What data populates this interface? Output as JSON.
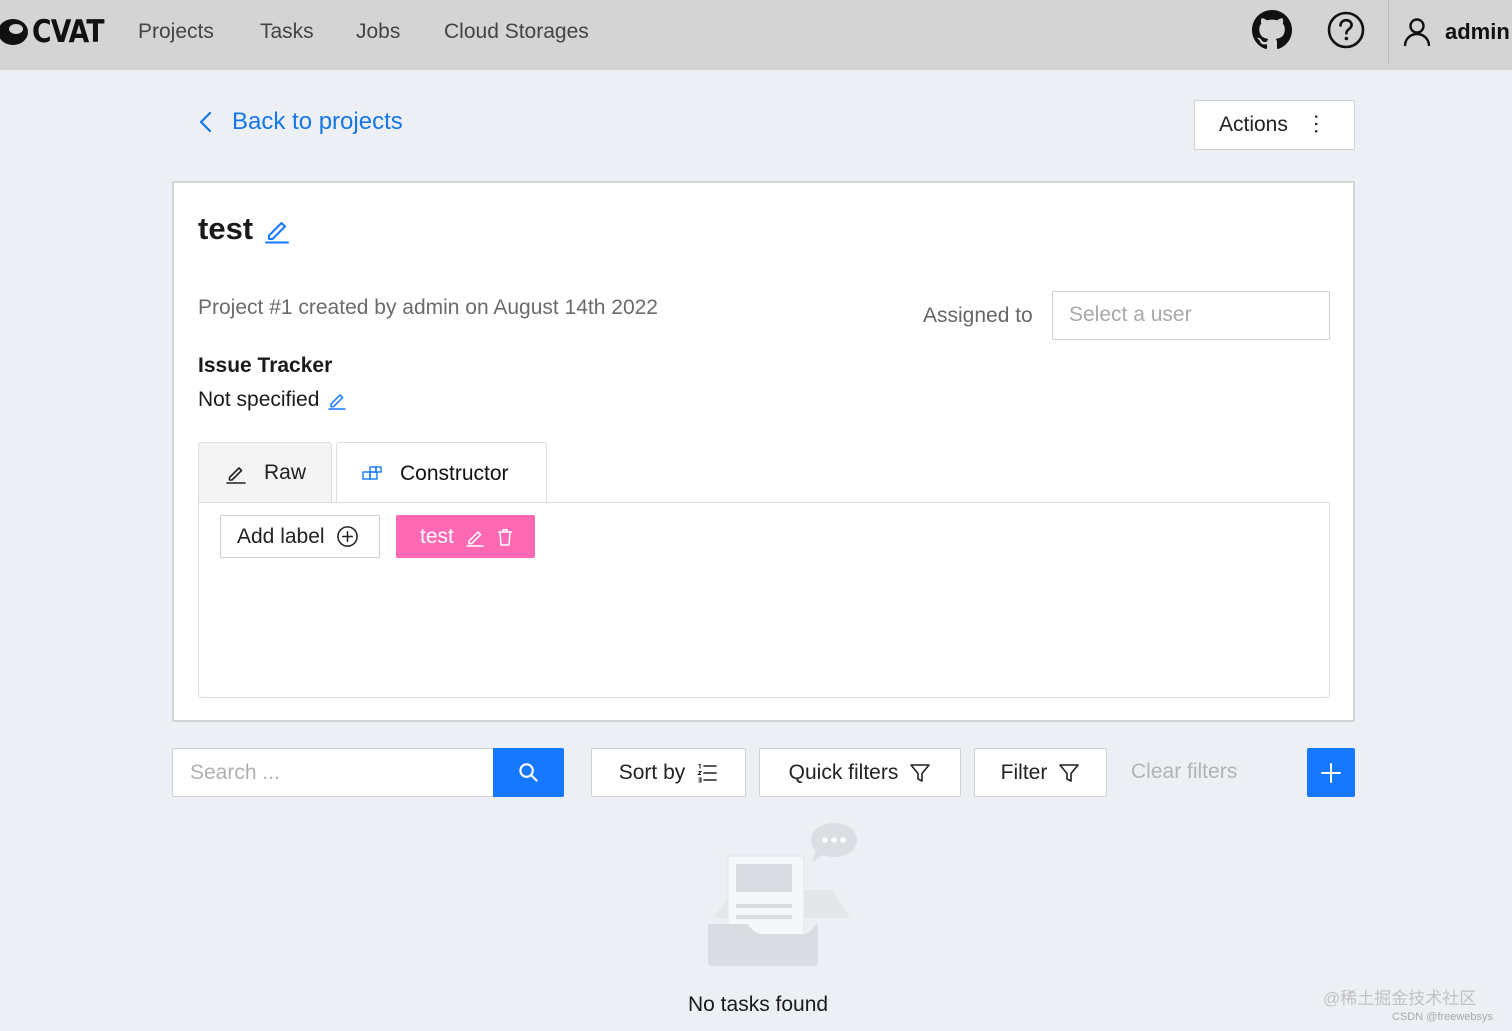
{
  "header": {
    "brand": "CVAT",
    "nav": [
      "Projects",
      "Tasks",
      "Jobs",
      "Cloud Storages"
    ],
    "user": "admin"
  },
  "back_link": "Back to projects",
  "actions_label": "Actions",
  "project": {
    "name": "test",
    "meta": "Project #1 created by admin on August 14th 2022",
    "assigned_label": "Assigned to",
    "assign_placeholder": "Select a user",
    "issue_tracker_heading": "Issue Tracker",
    "issue_tracker_value": "Not specified",
    "tabs": [
      "Raw",
      "Constructor"
    ],
    "active_tab": "Constructor",
    "add_label": "Add label",
    "labels": [
      {
        "name": "test",
        "color": "#ff69b4"
      }
    ]
  },
  "toolbar": {
    "search_placeholder": "Search ...",
    "sort_label": "Sort by",
    "quick_filters_label": "Quick filters",
    "filter_label": "Filter",
    "clear_filters_label": "Clear filters"
  },
  "empty_state": "No tasks found",
  "watermark": {
    "line1": "@稀土掘金技术社区",
    "line2": "CSDN @freewebsys"
  },
  "colors": {
    "accent": "#1677ff",
    "link": "#1677e6",
    "header_bg": "#d4d4d4",
    "page_bg": "#eceff3"
  }
}
